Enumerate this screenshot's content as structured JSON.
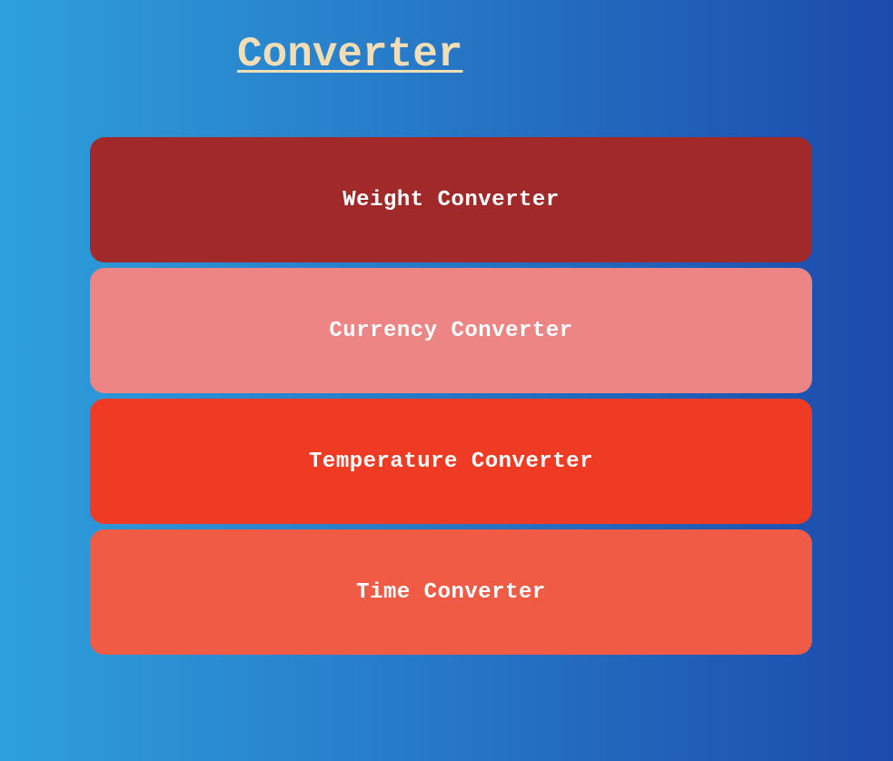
{
  "header": {
    "title": "Converter"
  },
  "converters": [
    {
      "label": "Weight Converter",
      "color": "#a2292a"
    },
    {
      "label": "Currency Converter",
      "color": "#ec8584"
    },
    {
      "label": "Temperature Converter",
      "color": "#ef3b24"
    },
    {
      "label": "Time Converter",
      "color": "#ef5b45"
    }
  ],
  "colors": {
    "background_gradient_start": "#2e9fdc",
    "background_gradient_end": "#1c4aac",
    "title_color": "#f2ddb4",
    "card_text": "#ffffff"
  }
}
